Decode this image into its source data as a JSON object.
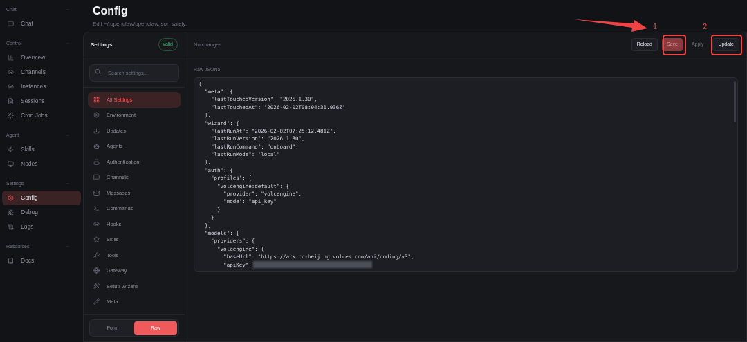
{
  "nav": [
    {
      "section": "Chat",
      "items": [
        {
          "label": "Chat",
          "selected": false
        }
      ]
    },
    {
      "section": "Control",
      "items": [
        {
          "label": "Overview",
          "selected": false
        },
        {
          "label": "Channels",
          "selected": false
        },
        {
          "label": "Instances",
          "selected": false
        },
        {
          "label": "Sessions",
          "selected": false
        },
        {
          "label": "Cron Jobs",
          "selected": false
        }
      ]
    },
    {
      "section": "Agent",
      "items": [
        {
          "label": "Skills",
          "selected": false
        },
        {
          "label": "Nodes",
          "selected": false
        }
      ]
    },
    {
      "section": "Settings",
      "items": [
        {
          "label": "Config",
          "selected": true
        },
        {
          "label": "Debug",
          "selected": false
        },
        {
          "label": "Logs",
          "selected": false
        }
      ]
    },
    {
      "section": "Resources",
      "items": [
        {
          "label": "Docs",
          "selected": false
        }
      ]
    }
  ],
  "page": {
    "title": "Config",
    "subtitle": "Edit ~/.openclaw/openclaw.json safely."
  },
  "settings_panel": {
    "title": "Settings",
    "badge": "valid",
    "search": {
      "placeholder": "Search settings..."
    },
    "items": [
      {
        "label": "All Settings",
        "selected": true
      },
      {
        "label": "Environment",
        "selected": false
      },
      {
        "label": "Updates",
        "selected": false
      },
      {
        "label": "Agents",
        "selected": false
      },
      {
        "label": "Authentication",
        "selected": false
      },
      {
        "label": "Channels",
        "selected": false
      },
      {
        "label": "Messages",
        "selected": false
      },
      {
        "label": "Commands",
        "selected": false
      },
      {
        "label": "Hooks",
        "selected": false
      },
      {
        "label": "Skills",
        "selected": false
      },
      {
        "label": "Tools",
        "selected": false
      },
      {
        "label": "Gateway",
        "selected": false
      },
      {
        "label": "Setup Wizard",
        "selected": false
      },
      {
        "label": "Meta",
        "selected": false
      }
    ],
    "mode_toggle": [
      {
        "label": "Form",
        "selected": false
      },
      {
        "label": "Raw",
        "selected": true
      }
    ]
  },
  "editor": {
    "status": "No changes",
    "buttons": [
      {
        "label": "Reload",
        "kind": "plain"
      },
      {
        "label": "Save",
        "kind": "primary"
      },
      {
        "label": "Apply",
        "kind": "ghost"
      },
      {
        "label": "Update",
        "kind": "plain"
      }
    ],
    "label": "Raw JSON5",
    "lines": [
      "{",
      "  \"meta\": {",
      "    \"lastTouchedVersion\": \"2026.1.30\",",
      "    \"lastTouchedAt\": \"2026-02-02T08:04:31.936Z\"",
      "  },",
      "  \"wizard\": {",
      "    \"lastRunAt\": \"2026-02-02T07:25:12.481Z\",",
      "    \"lastRunVersion\": \"2026.1.30\",",
      "    \"lastRunCommand\": \"onboard\",",
      "    \"lastRunMode\": \"local\"",
      "  },",
      "  \"auth\": {",
      "    \"profiles\": {",
      "      \"volcengine:default\": {",
      "        \"provider\": \"volcengine\",",
      "        \"mode\": \"api_key\"",
      "      }",
      "    }",
      "  },",
      "  \"models\": {",
      "    \"providers\": {",
      "      \"volcengine\": {",
      "        \"baseUrl\": \"https://ark.cn-beijing.volces.com/api/coding/v3\",",
      "        \"apiKey\":"
    ]
  },
  "annotations": [
    {
      "label": "1."
    },
    {
      "label": "2."
    }
  ]
}
